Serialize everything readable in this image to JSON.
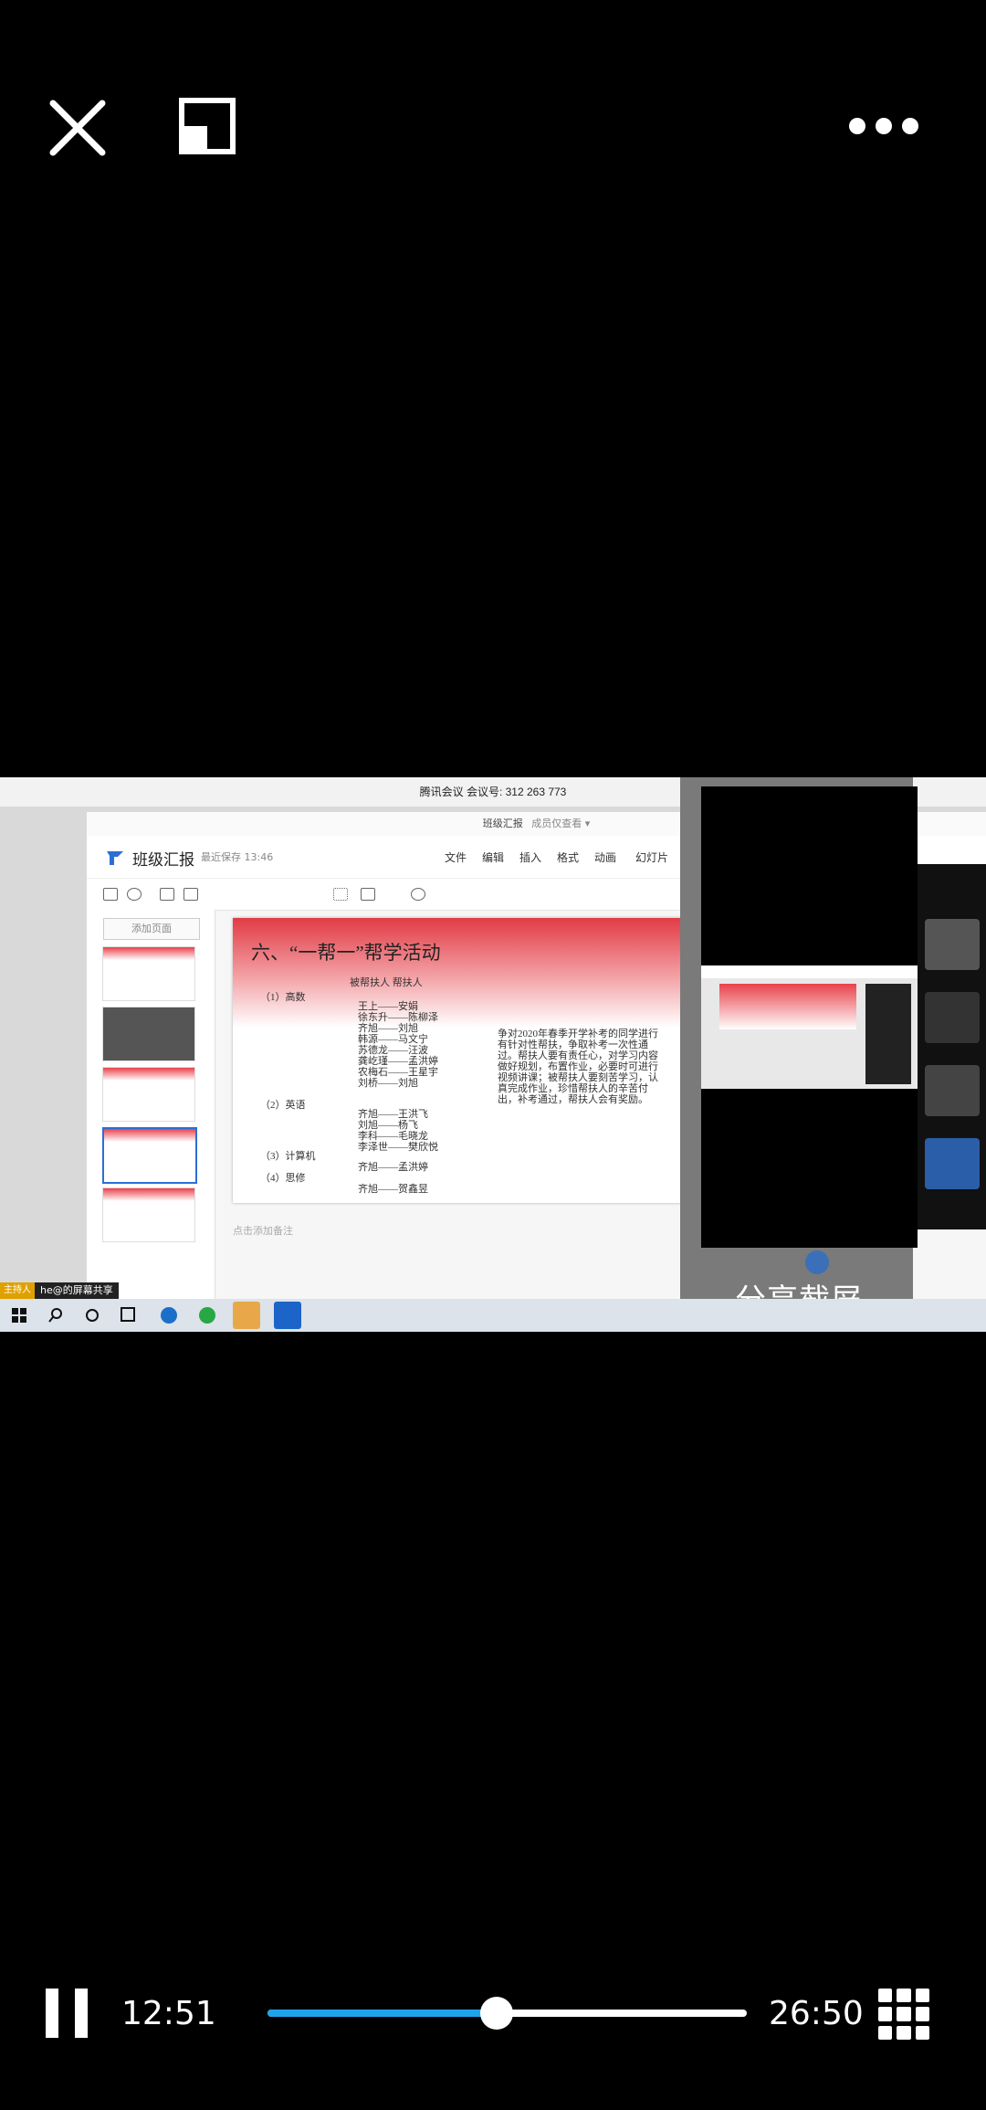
{
  "player": {
    "current_time": "12:51",
    "total_time": "26:50",
    "progress": 0.479,
    "accent_color": "#1fa3e8",
    "icons": [
      "close-icon",
      "pip-icon",
      "more-icon",
      "pause-icon",
      "grid-icon"
    ]
  },
  "video": {
    "meeting_title": "腾讯会议 会议号: 312 263 773",
    "doc_window_title": "班级汇报",
    "doc_window_title_suffix": "成员仅查看 ▾",
    "app_name": "班级汇报",
    "saved_status": "最近保存 13:46",
    "menu": [
      "文件",
      "编辑",
      "插入",
      "格式",
      "动画",
      "幻灯片"
    ],
    "add_page": "添加页面",
    "notes_placeholder": "点击添加备注",
    "share_overlay": "分享截屏",
    "host_tag": "主持人",
    "host_share": "he@的屏幕共享",
    "slide": {
      "title": "六、“一帮一”帮学活动",
      "header": "被帮扶人    帮扶人",
      "subjects": [
        "（1）高数",
        "（2）英语",
        "（3）计算机",
        "（4）思修"
      ],
      "math_pairs": [
        "王上——安娟",
        "徐东升——陈柳泽",
        "齐旭——刘旭",
        "韩源——马文宁",
        "苏德龙——汪波",
        "龚屹瑾——孟洪婷",
        "农梅石——王星宇",
        "刘桥——刘旭"
      ],
      "english_pairs": [
        "齐旭——王洪飞",
        "刘旭——杨飞",
        "李科——毛晓龙",
        "李泽世——樊欣悦"
      ],
      "computer_pairs": [
        "齐旭——孟洪婷"
      ],
      "politics_pairs": [
        "齐旭——贺鑫昱"
      ],
      "paragraph": [
        "争对2020年春季开学补考的同学进行",
        "有针对性帮扶，争取补考一次性通",
        "过。帮扶人要有责任心，对学习内容",
        "做好规划，布置作业，必要时可进行",
        "视频讲课；被帮扶人要刻苦学习，认",
        "真完成作业，珍惜帮扶人的辛苦付",
        "出，补考通过，帮扶人会有奖励。"
      ]
    }
  }
}
